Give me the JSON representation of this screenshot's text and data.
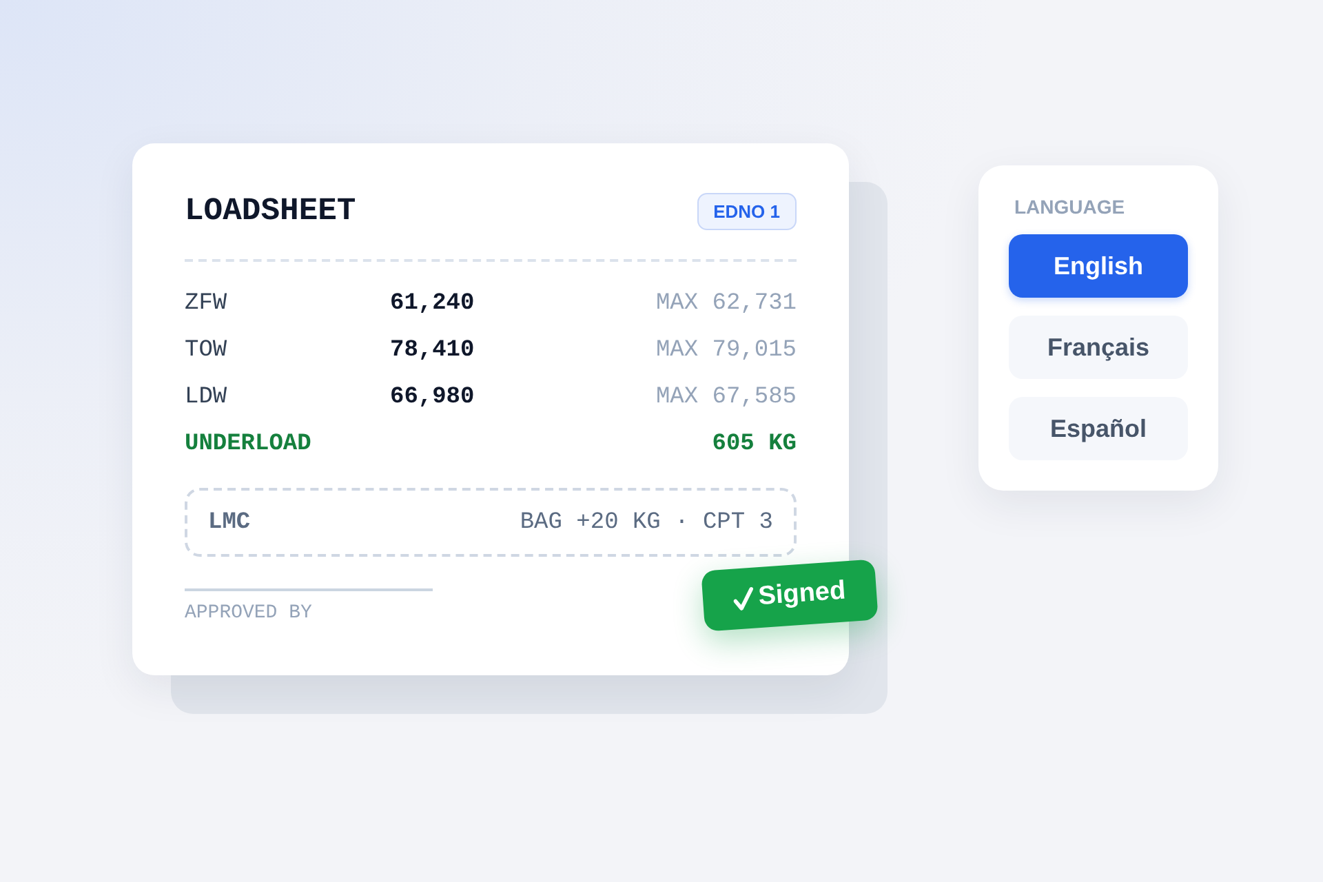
{
  "loadsheet": {
    "title": "LOADSHEET",
    "badge": "EDNO 1",
    "weights": [
      {
        "label": "ZFW",
        "value": "61,240",
        "limit": "MAX 62,731"
      },
      {
        "label": "TOW",
        "value": "78,410",
        "limit": "MAX 79,015"
      },
      {
        "label": "LDW",
        "value": "66,980",
        "limit": "MAX 67,585"
      }
    ],
    "underload": {
      "label": "UNDERLOAD",
      "value": "605 KG"
    },
    "lmc": {
      "label": "LMC",
      "detail": "BAG +20 KG · CPT 3"
    },
    "signature": {
      "caption": "APPROVED BY"
    },
    "stamp": {
      "label": "Signed"
    }
  },
  "language": {
    "title": "LANGUAGE",
    "options": [
      {
        "label": "English",
        "selected": true
      },
      {
        "label": "Français",
        "selected": false
      },
      {
        "label": "Español",
        "selected": false
      }
    ]
  }
}
